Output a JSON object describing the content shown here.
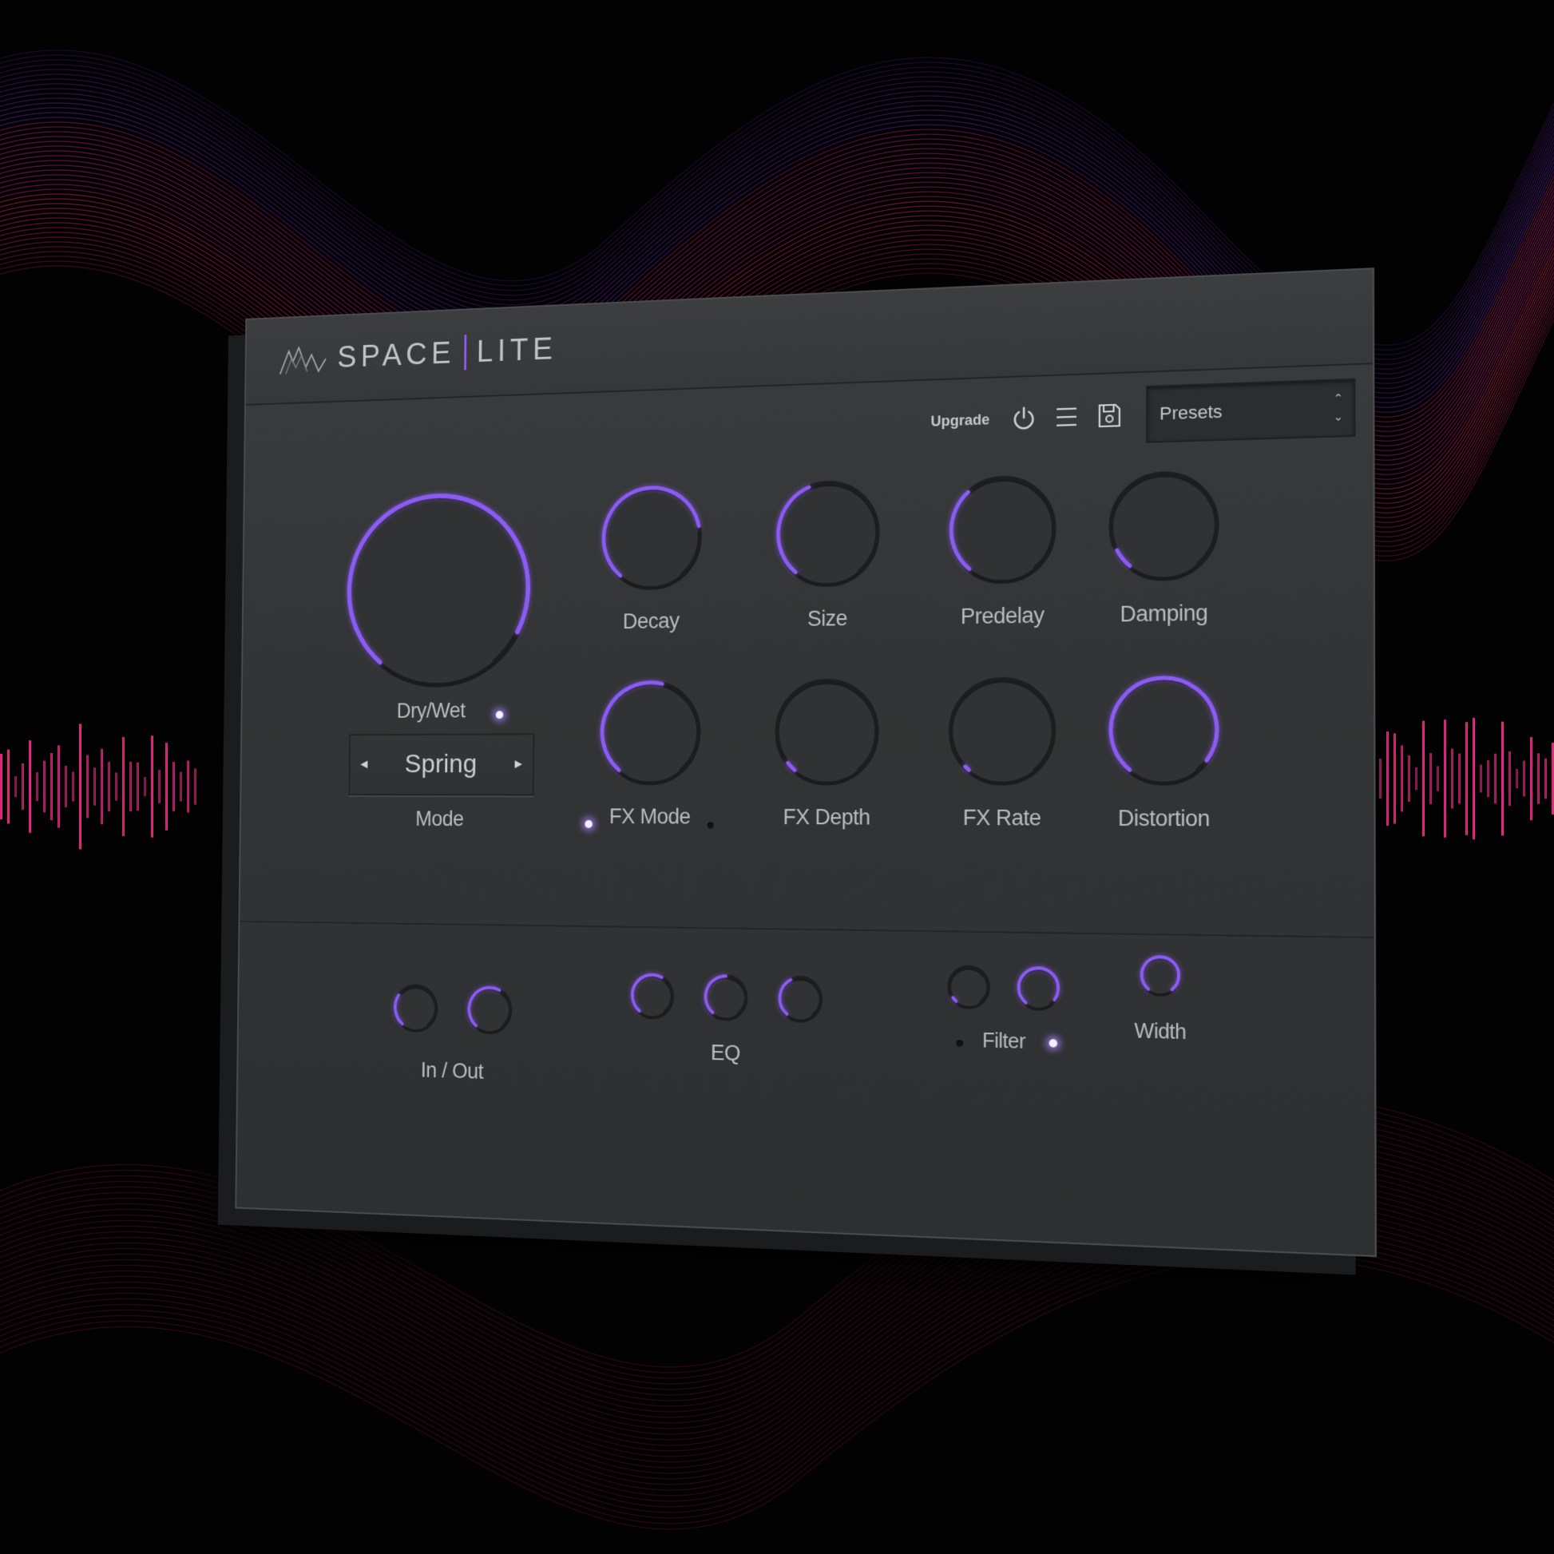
{
  "app": {
    "brand_left": "SPACE",
    "brand_right": "LITE",
    "accent_color": "#8a5cf0"
  },
  "toolbar": {
    "upgrade_label": "Upgrade",
    "icons": [
      "power-icon",
      "menu-icon",
      "save-icon"
    ],
    "presets_label": "Presets"
  },
  "main": {
    "drywet": {
      "label": "Dry/Wet",
      "value": 0.92,
      "led": "on"
    },
    "mode": {
      "value": "Spring",
      "label": "Mode",
      "prev": "◂",
      "next": "▸"
    },
    "knobs": [
      {
        "id": "decay",
        "label": "Decay",
        "value": 0.78
      },
      {
        "id": "size",
        "label": "Size",
        "value": 0.42
      },
      {
        "id": "predelay",
        "label": "Predelay",
        "value": 0.35
      },
      {
        "id": "damping",
        "label": "Damping",
        "value": 0.08
      },
      {
        "id": "fxmode",
        "label": "FX Mode",
        "value": 0.55
      },
      {
        "id": "fxdepth",
        "label": "FX Depth",
        "value": 0.04
      },
      {
        "id": "fxrate",
        "label": "FX Rate",
        "value": 0.02
      },
      {
        "id": "distortion",
        "label": "Distortion",
        "value": 0.95
      }
    ]
  },
  "bottom": {
    "inout": {
      "label": "In / Out",
      "values": [
        0.3,
        0.6
      ]
    },
    "eq": {
      "label": "EQ",
      "values": [
        0.6,
        0.5,
        0.4
      ]
    },
    "filter": {
      "label": "Filter",
      "values": [
        0.05,
        0.95
      ]
    },
    "width": {
      "label": "Width",
      "value": 1.0
    }
  }
}
